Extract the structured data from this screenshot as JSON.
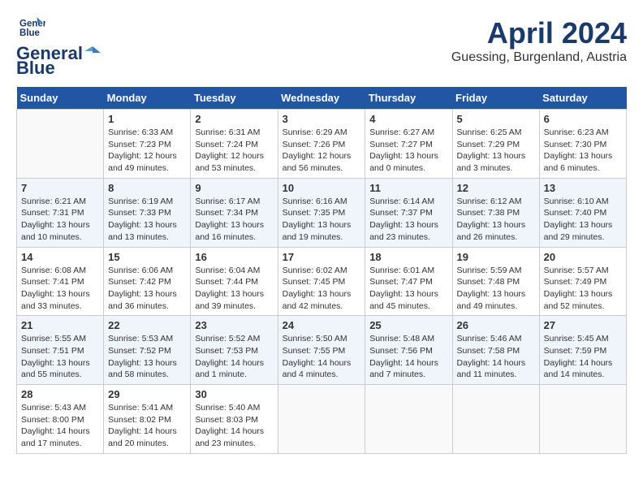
{
  "header": {
    "logo_line1": "General",
    "logo_line2": "Blue",
    "month": "April 2024",
    "location": "Guessing, Burgenland, Austria"
  },
  "columns": [
    "Sunday",
    "Monday",
    "Tuesday",
    "Wednesday",
    "Thursday",
    "Friday",
    "Saturday"
  ],
  "weeks": [
    [
      {
        "day": "",
        "info": ""
      },
      {
        "day": "1",
        "info": "Sunrise: 6:33 AM\nSunset: 7:23 PM\nDaylight: 12 hours\nand 49 minutes."
      },
      {
        "day": "2",
        "info": "Sunrise: 6:31 AM\nSunset: 7:24 PM\nDaylight: 12 hours\nand 53 minutes."
      },
      {
        "day": "3",
        "info": "Sunrise: 6:29 AM\nSunset: 7:26 PM\nDaylight: 12 hours\nand 56 minutes."
      },
      {
        "day": "4",
        "info": "Sunrise: 6:27 AM\nSunset: 7:27 PM\nDaylight: 13 hours\nand 0 minutes."
      },
      {
        "day": "5",
        "info": "Sunrise: 6:25 AM\nSunset: 7:29 PM\nDaylight: 13 hours\nand 3 minutes."
      },
      {
        "day": "6",
        "info": "Sunrise: 6:23 AM\nSunset: 7:30 PM\nDaylight: 13 hours\nand 6 minutes."
      }
    ],
    [
      {
        "day": "7",
        "info": "Sunrise: 6:21 AM\nSunset: 7:31 PM\nDaylight: 13 hours\nand 10 minutes."
      },
      {
        "day": "8",
        "info": "Sunrise: 6:19 AM\nSunset: 7:33 PM\nDaylight: 13 hours\nand 13 minutes."
      },
      {
        "day": "9",
        "info": "Sunrise: 6:17 AM\nSunset: 7:34 PM\nDaylight: 13 hours\nand 16 minutes."
      },
      {
        "day": "10",
        "info": "Sunrise: 6:16 AM\nSunset: 7:35 PM\nDaylight: 13 hours\nand 19 minutes."
      },
      {
        "day": "11",
        "info": "Sunrise: 6:14 AM\nSunset: 7:37 PM\nDaylight: 13 hours\nand 23 minutes."
      },
      {
        "day": "12",
        "info": "Sunrise: 6:12 AM\nSunset: 7:38 PM\nDaylight: 13 hours\nand 26 minutes."
      },
      {
        "day": "13",
        "info": "Sunrise: 6:10 AM\nSunset: 7:40 PM\nDaylight: 13 hours\nand 29 minutes."
      }
    ],
    [
      {
        "day": "14",
        "info": "Sunrise: 6:08 AM\nSunset: 7:41 PM\nDaylight: 13 hours\nand 33 minutes."
      },
      {
        "day": "15",
        "info": "Sunrise: 6:06 AM\nSunset: 7:42 PM\nDaylight: 13 hours\nand 36 minutes."
      },
      {
        "day": "16",
        "info": "Sunrise: 6:04 AM\nSunset: 7:44 PM\nDaylight: 13 hours\nand 39 minutes."
      },
      {
        "day": "17",
        "info": "Sunrise: 6:02 AM\nSunset: 7:45 PM\nDaylight: 13 hours\nand 42 minutes."
      },
      {
        "day": "18",
        "info": "Sunrise: 6:01 AM\nSunset: 7:47 PM\nDaylight: 13 hours\nand 45 minutes."
      },
      {
        "day": "19",
        "info": "Sunrise: 5:59 AM\nSunset: 7:48 PM\nDaylight: 13 hours\nand 49 minutes."
      },
      {
        "day": "20",
        "info": "Sunrise: 5:57 AM\nSunset: 7:49 PM\nDaylight: 13 hours\nand 52 minutes."
      }
    ],
    [
      {
        "day": "21",
        "info": "Sunrise: 5:55 AM\nSunset: 7:51 PM\nDaylight: 13 hours\nand 55 minutes."
      },
      {
        "day": "22",
        "info": "Sunrise: 5:53 AM\nSunset: 7:52 PM\nDaylight: 13 hours\nand 58 minutes."
      },
      {
        "day": "23",
        "info": "Sunrise: 5:52 AM\nSunset: 7:53 PM\nDaylight: 14 hours\nand 1 minute."
      },
      {
        "day": "24",
        "info": "Sunrise: 5:50 AM\nSunset: 7:55 PM\nDaylight: 14 hours\nand 4 minutes."
      },
      {
        "day": "25",
        "info": "Sunrise: 5:48 AM\nSunset: 7:56 PM\nDaylight: 14 hours\nand 7 minutes."
      },
      {
        "day": "26",
        "info": "Sunrise: 5:46 AM\nSunset: 7:58 PM\nDaylight: 14 hours\nand 11 minutes."
      },
      {
        "day": "27",
        "info": "Sunrise: 5:45 AM\nSunset: 7:59 PM\nDaylight: 14 hours\nand 14 minutes."
      }
    ],
    [
      {
        "day": "28",
        "info": "Sunrise: 5:43 AM\nSunset: 8:00 PM\nDaylight: 14 hours\nand 17 minutes."
      },
      {
        "day": "29",
        "info": "Sunrise: 5:41 AM\nSunset: 8:02 PM\nDaylight: 14 hours\nand 20 minutes."
      },
      {
        "day": "30",
        "info": "Sunrise: 5:40 AM\nSunset: 8:03 PM\nDaylight: 14 hours\nand 23 minutes."
      },
      {
        "day": "",
        "info": ""
      },
      {
        "day": "",
        "info": ""
      },
      {
        "day": "",
        "info": ""
      },
      {
        "day": "",
        "info": ""
      }
    ]
  ]
}
